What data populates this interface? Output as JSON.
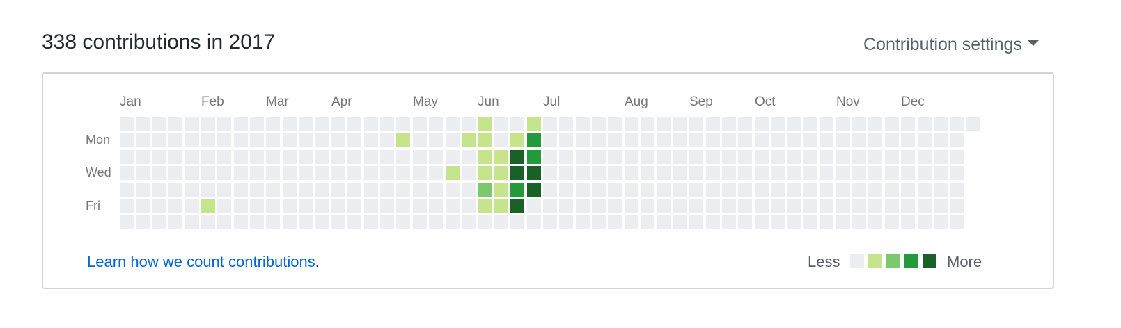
{
  "header": {
    "title": "338 contributions in 2017",
    "settings_label": "Contribution settings"
  },
  "calendar": {
    "months": [
      "Jan",
      "Feb",
      "Mar",
      "Apr",
      "May",
      "Jun",
      "Jul",
      "Aug",
      "Sep",
      "Oct",
      "Nov",
      "Dec"
    ],
    "day_labels": [
      "Mon",
      "Wed",
      "Fri"
    ],
    "colors": [
      "#ebedf0",
      "#c6e48b",
      "#7bc96f",
      "#239a3b",
      "#196127"
    ],
    "active_cells": [
      {
        "week": 5,
        "day": 5,
        "level": 1
      },
      {
        "week": 17,
        "day": 1,
        "level": 1
      },
      {
        "week": 20,
        "day": 3,
        "level": 1
      },
      {
        "week": 21,
        "day": 1,
        "level": 1
      },
      {
        "week": 22,
        "day": 0,
        "level": 1
      },
      {
        "week": 22,
        "day": 1,
        "level": 1
      },
      {
        "week": 22,
        "day": 2,
        "level": 1
      },
      {
        "week": 22,
        "day": 3,
        "level": 1
      },
      {
        "week": 22,
        "day": 4,
        "level": 2
      },
      {
        "week": 22,
        "day": 5,
        "level": 1
      },
      {
        "week": 23,
        "day": 2,
        "level": 1
      },
      {
        "week": 23,
        "day": 3,
        "level": 1
      },
      {
        "week": 23,
        "day": 4,
        "level": 1
      },
      {
        "week": 23,
        "day": 5,
        "level": 1
      },
      {
        "week": 24,
        "day": 1,
        "level": 1
      },
      {
        "week": 24,
        "day": 2,
        "level": 4
      },
      {
        "week": 24,
        "day": 3,
        "level": 4
      },
      {
        "week": 24,
        "day": 4,
        "level": 3
      },
      {
        "week": 24,
        "day": 5,
        "level": 4
      },
      {
        "week": 25,
        "day": 0,
        "level": 1
      },
      {
        "week": 25,
        "day": 1,
        "level": 3
      },
      {
        "week": 25,
        "day": 2,
        "level": 3
      },
      {
        "week": 25,
        "day": 3,
        "level": 4
      },
      {
        "week": 25,
        "day": 4,
        "level": 4
      }
    ]
  },
  "footer": {
    "learn_link": "Learn how we count contributions",
    "learn_period": ".",
    "legend_less": "Less",
    "legend_more": "More"
  }
}
